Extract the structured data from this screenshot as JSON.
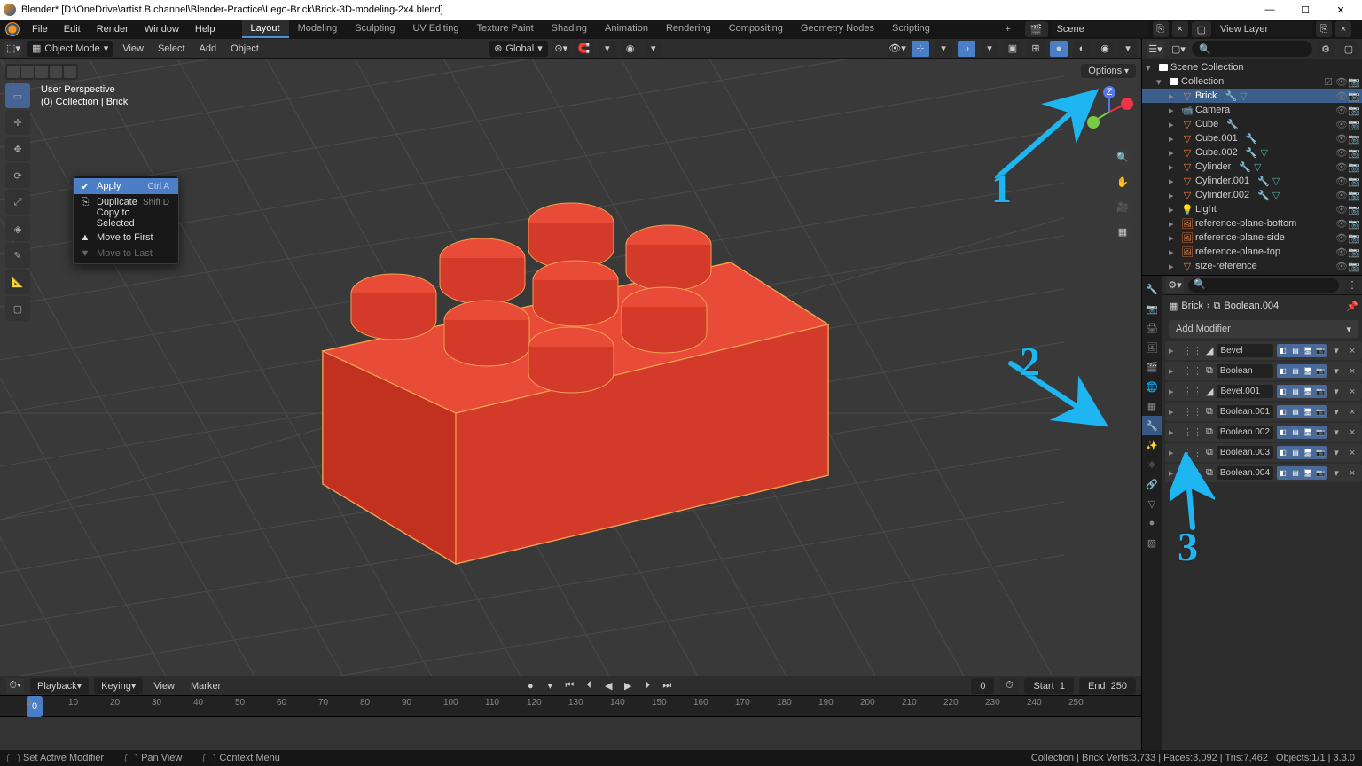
{
  "title": "Blender* [D:\\OneDrive\\artist.B.channel\\Blender-Practice\\Lego-Brick\\Brick-3D-modeling-2x4.blend]",
  "menu": {
    "file": "File",
    "edit": "Edit",
    "render": "Render",
    "window": "Window",
    "help": "Help"
  },
  "workspaces": [
    "Layout",
    "Modeling",
    "Sculpting",
    "UV Editing",
    "Texture Paint",
    "Shading",
    "Animation",
    "Rendering",
    "Compositing",
    "Geometry Nodes",
    "Scripting"
  ],
  "active_workspace": "Layout",
  "scene": {
    "label": "Scene",
    "layer": "View Layer"
  },
  "viewport_header": {
    "mode": "Object Mode",
    "view": "View",
    "select": "Select",
    "add": "Add",
    "object": "Object",
    "global": "Global",
    "options": "Options"
  },
  "viewport_info": {
    "persp": "User Perspective",
    "path": "(0) Collection | Brick"
  },
  "outliner": {
    "scene_collection": "Scene Collection",
    "collection": "Collection",
    "items": [
      {
        "name": "Brick",
        "type": "mesh",
        "selected": true,
        "mods": 2
      },
      {
        "name": "Camera",
        "type": "cam"
      },
      {
        "name": "Cube",
        "type": "mesh",
        "mods": 1
      },
      {
        "name": "Cube.001",
        "type": "mesh",
        "mods": 1
      },
      {
        "name": "Cube.002",
        "type": "mesh",
        "mods": 2
      },
      {
        "name": "Cylinder",
        "type": "mesh",
        "mods": 2
      },
      {
        "name": "Cylinder.001",
        "type": "mesh",
        "mods": 2
      },
      {
        "name": "Cylinder.002",
        "type": "mesh",
        "mods": 2
      },
      {
        "name": "Light",
        "type": "light"
      },
      {
        "name": "reference-plane-bottom",
        "type": "img"
      },
      {
        "name": "reference-plane-side",
        "type": "img"
      },
      {
        "name": "reference-plane-top",
        "type": "img"
      },
      {
        "name": "size-reference",
        "type": "mesh"
      }
    ]
  },
  "properties": {
    "breadcrumb_obj": "Brick",
    "breadcrumb_mod": "Boolean.004",
    "add_modifier": "Add Modifier",
    "modifiers": [
      {
        "name": "Bevel",
        "icon": "bevel"
      },
      {
        "name": "Boolean",
        "icon": "bool"
      },
      {
        "name": "Bevel.001",
        "icon": "bevel"
      },
      {
        "name": "Boolean.001",
        "icon": "bool"
      },
      {
        "name": "Boolean.002",
        "icon": "bool"
      },
      {
        "name": "Boolean.003",
        "icon": "bool"
      },
      {
        "name": "Boolean.004",
        "icon": "bool"
      }
    ]
  },
  "context_menu": {
    "apply": "Apply",
    "apply_sc": "Ctrl A",
    "duplicate": "Duplicate",
    "dup_sc": "Shift D",
    "copy": "Copy to Selected",
    "move_first": "Move to First",
    "move_last": "Move to Last"
  },
  "timeline": {
    "playback": "Playback",
    "keying": "Keying",
    "view": "View",
    "marker": "Marker",
    "cur_frame": "0",
    "start_label": "Start",
    "start": "1",
    "end_label": "End",
    "end": "250",
    "ticks": [
      0,
      10,
      20,
      30,
      40,
      50,
      60,
      70,
      80,
      90,
      100,
      110,
      120,
      130,
      140,
      150,
      160,
      170,
      180,
      190,
      200,
      210,
      220,
      230,
      240,
      250
    ]
  },
  "statusbar": {
    "set_active": "Set Active Modifier",
    "pan": "Pan View",
    "context": "Context Menu",
    "info": "Collection | Brick    Verts:3,733 | Faces:3,092 | Tris:7,462 | Objects:1/1 | 3.3.0"
  },
  "annotations": {
    "n1": "1",
    "n2": "2",
    "n3": "3"
  }
}
